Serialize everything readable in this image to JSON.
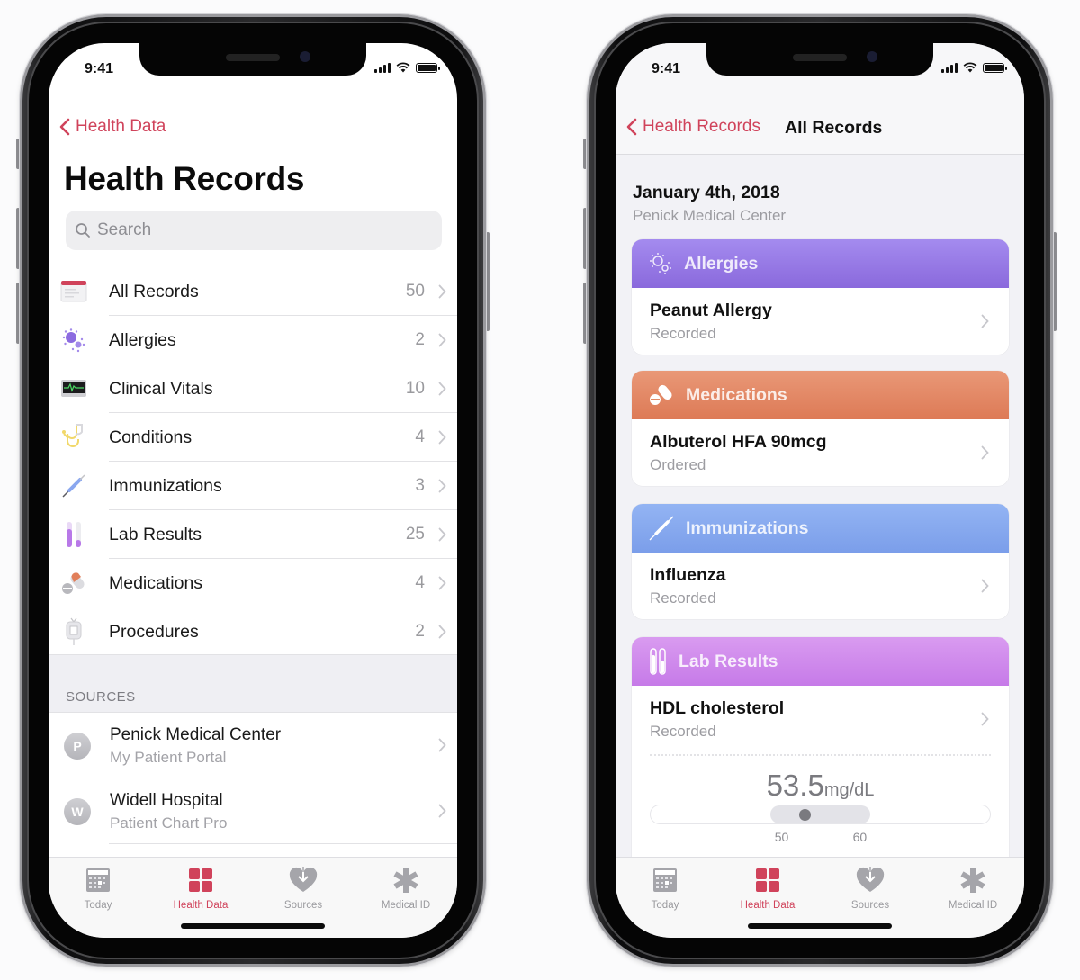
{
  "colors": {
    "accent": "#d0435b",
    "allergies": "#8c6be0",
    "medications": "#e17f5a",
    "immunizations": "#7ea2ec",
    "lab_results": "#c97ae8",
    "tab_inactive": "#9a9a9e",
    "background": "#fbfbfc"
  },
  "left_phone": {
    "status_bar": {
      "time": "9:41"
    },
    "nav": {
      "back_label": "Health Data"
    },
    "title": "Health Records",
    "search": {
      "placeholder": "Search",
      "value": ""
    },
    "categories": [
      {
        "label": "All Records",
        "count": "50",
        "icon": "calendar-records-icon"
      },
      {
        "label": "Allergies",
        "count": "2",
        "icon": "allergen-icon"
      },
      {
        "label": "Clinical Vitals",
        "count": "10",
        "icon": "vitals-monitor-icon"
      },
      {
        "label": "Conditions",
        "count": "4",
        "icon": "stethoscope-icon"
      },
      {
        "label": "Immunizations",
        "count": "3",
        "icon": "syringe-icon"
      },
      {
        "label": "Lab Results",
        "count": "25",
        "icon": "test-tubes-icon"
      },
      {
        "label": "Medications",
        "count": "4",
        "icon": "pills-icon"
      },
      {
        "label": "Procedures",
        "count": "2",
        "icon": "iv-bag-icon"
      }
    ],
    "sources_header": "SOURCES",
    "sources": [
      {
        "initial": "P",
        "name": "Penick Medical Center",
        "subtitle": "My Patient Portal"
      },
      {
        "initial": "W",
        "name": "Widell Hospital",
        "subtitle": "Patient Chart Pro"
      }
    ]
  },
  "right_phone": {
    "status_bar": {
      "time": "9:41"
    },
    "nav": {
      "back_label": "Health Records",
      "title": "All Records"
    },
    "date": "January 4th, 2018",
    "source": "Penick Medical Center",
    "records": [
      {
        "category": "Allergies",
        "icon": "allergen-icon",
        "item": "Peanut Allergy",
        "status": "Recorded"
      },
      {
        "category": "Medications",
        "icon": "pills-icon",
        "item": "Albuterol HFA 90mcg",
        "status": "Ordered"
      },
      {
        "category": "Immunizations",
        "icon": "syringe-icon",
        "item": "Influenza",
        "status": "Recorded"
      },
      {
        "category": "Lab Results",
        "icon": "test-tubes-icon",
        "item": "HDL cholesterol",
        "status": "Recorded"
      }
    ],
    "lab_result": {
      "value": "53.5",
      "unit": "mg/dL",
      "range_low": 50,
      "range_high": 60,
      "range_low_label": "50",
      "range_high_label": "60",
      "scale_min": 38,
      "scale_max": 72
    }
  },
  "tabbar": {
    "tabs": [
      {
        "label": "Today",
        "icon": "calendar-icon",
        "active": false
      },
      {
        "label": "Health Data",
        "icon": "grid-icon",
        "active": true
      },
      {
        "label": "Sources",
        "icon": "heart-download-icon",
        "active": false
      },
      {
        "label": "Medical ID",
        "icon": "asterisk-icon",
        "active": false
      }
    ]
  }
}
